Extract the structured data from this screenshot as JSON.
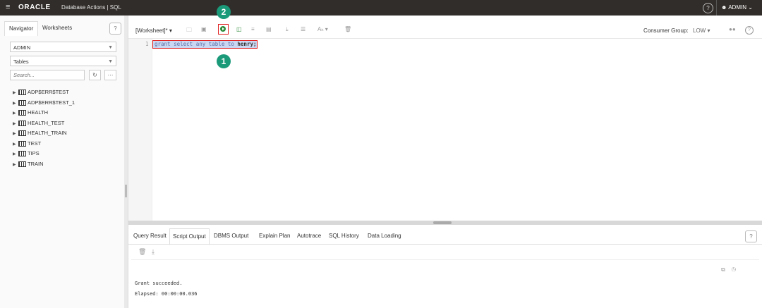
{
  "topbar": {
    "menu_icon": "hamburger-icon",
    "brand": "ORACLE",
    "app_title": "Database Actions | SQL",
    "help_icon": "help-circle-icon",
    "user_label": "ADMIN"
  },
  "navigator": {
    "tabs": [
      "Navigator",
      "Worksheets"
    ],
    "schema": "ADMIN",
    "object_type": "Tables",
    "search_placeholder": "Search...",
    "tables": [
      "ADP$ERR$TEST",
      "ADP$ERR$TEST_1",
      "HEALTH",
      "HEALTH_TEST",
      "HEALTH_TRAIN",
      "TEST",
      "TIPS",
      "TRAIN"
    ]
  },
  "toolbar": {
    "worksheet_name": "[Worksheet]*",
    "consumer_group_label": "Consumer Group:",
    "consumer_group_value": "LOW",
    "run_icon": "run-statement-icon",
    "font_label": "A  "
  },
  "editor": {
    "line_number": "1",
    "sql_pre": "grant select any table to ",
    "sql_user": "henry;"
  },
  "callouts": [
    "1",
    "2"
  ],
  "output": {
    "tabs": [
      "Query Result",
      "Script Output",
      "DBMS Output",
      "Explain Plan",
      "Autotrace",
      "SQL History",
      "Data Loading"
    ],
    "active_tab": "Script Output",
    "line1": "Grant succeeded.",
    "line2": "Elapsed: 00:00:00.036"
  },
  "colors": {
    "topbar": "#312d2a",
    "highlight_red": "#e02020",
    "callout_teal": "#1b9a7a",
    "run_green": "#2e8b3a"
  }
}
